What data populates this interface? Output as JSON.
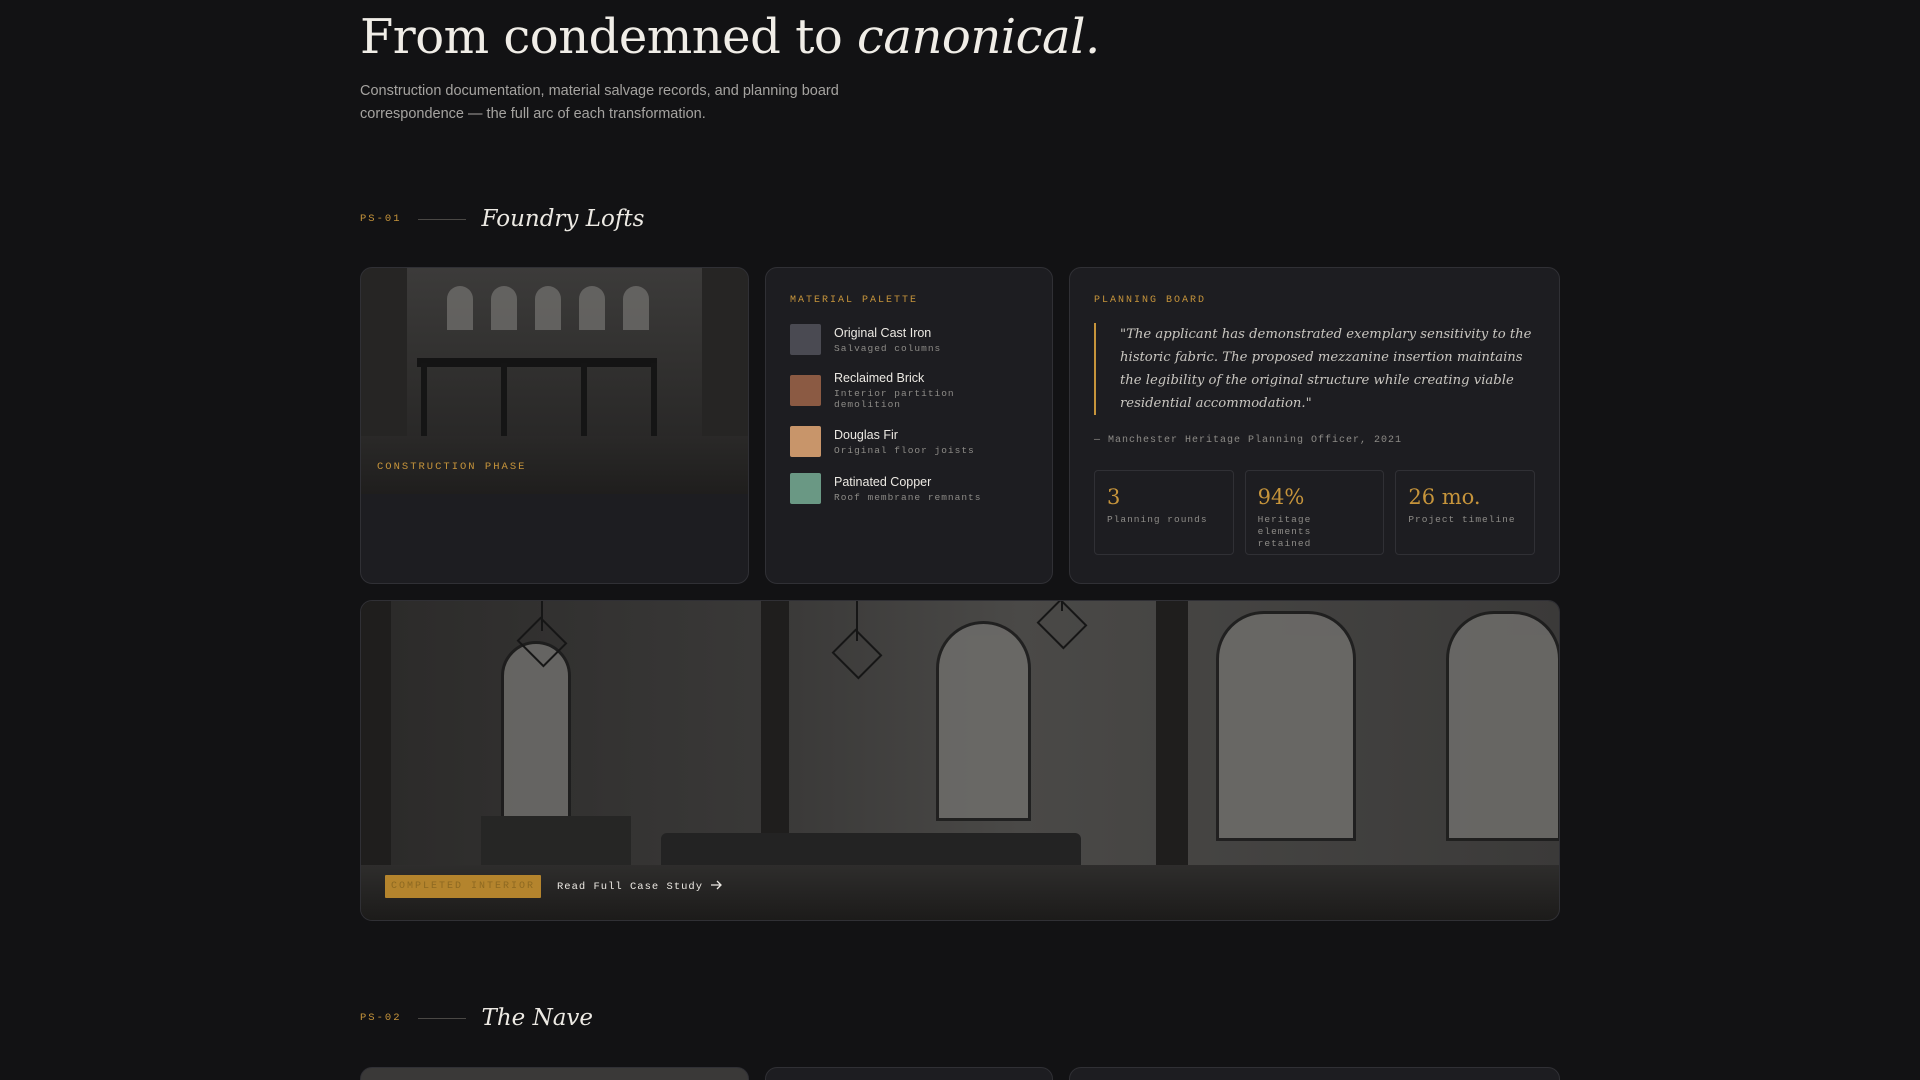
{
  "hero": {
    "title_plain": "From condemned to ",
    "title_italic": "canonical.",
    "subtitle": "Construction documentation, material salvage records, and planning board correspondence — the full arc of each transformation."
  },
  "sections": [
    {
      "code": "PS-01",
      "title": "Foundry Lofts",
      "construction_label": "CONSTRUCTION PHASE",
      "palette": {
        "label": "MATERIAL PALETTE",
        "items": [
          {
            "name": "Original Cast Iron",
            "desc": "Salvaged columns",
            "color": "#4a4a52"
          },
          {
            "name": "Reclaimed Brick",
            "desc": "Interior partition demolition",
            "color": "#8b5a43"
          },
          {
            "name": "Douglas Fir",
            "desc": "Original floor joists",
            "color": "#c8956a"
          },
          {
            "name": "Patinated Copper",
            "desc": "Roof membrane remnants",
            "color": "#6a9884"
          }
        ]
      },
      "planning": {
        "label": "PLANNING BOARD",
        "quote": "\"The applicant has demonstrated exemplary sensitivity to the historic fabric. The proposed mezzanine insertion maintains the legibility of the original structure while creating viable residential accommodation.\"",
        "source": "— Manchester Heritage Planning Officer, 2021",
        "stats": [
          {
            "value": "3",
            "label": "Planning rounds"
          },
          {
            "value": "94%",
            "label": "Heritage elements retained"
          },
          {
            "value": "26 mo.",
            "label": "Project timeline"
          }
        ]
      },
      "completed_badge": "COMPLETED INTERIOR",
      "read_more": "Read Full Case Study"
    },
    {
      "code": "PS-02",
      "title": "The Nave"
    }
  ],
  "colors": {
    "accent": "#c6943b",
    "background": "#121214",
    "card": "#1d1d21"
  },
  "icons": {
    "read_more": "arrow-right-icon"
  }
}
